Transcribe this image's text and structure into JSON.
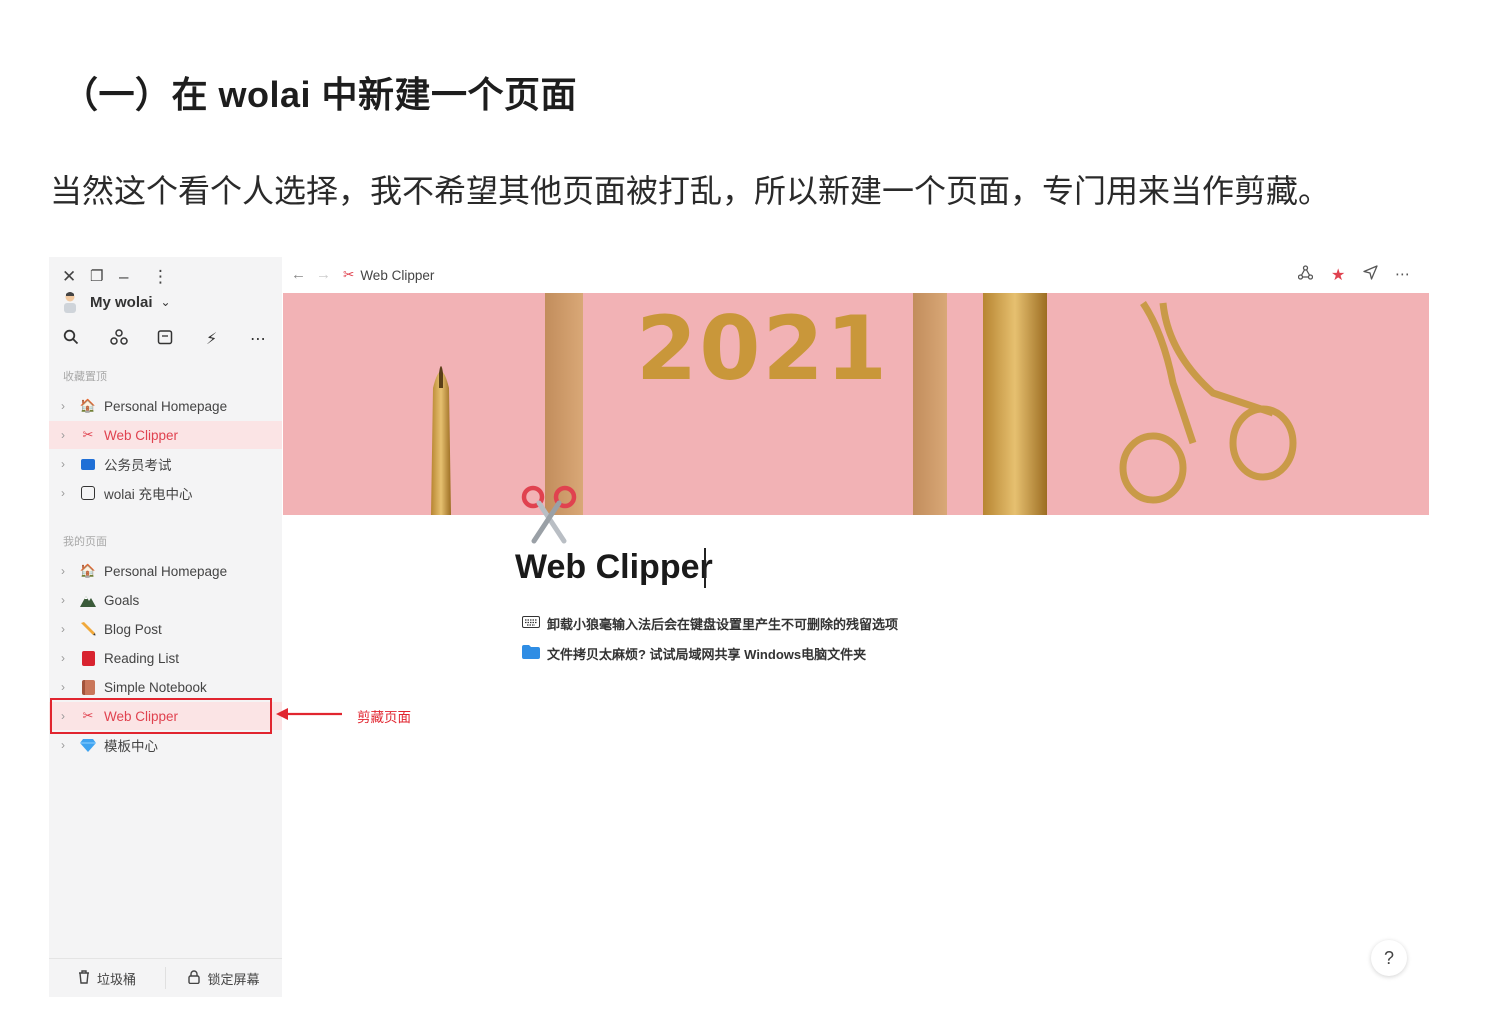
{
  "heading": "（一）在 wolai 中新建一个页面",
  "paragraph": "当然这个看个人选择，我不希望其他页面被打乱，所以新建一个页面，专门用来当作剪藏。",
  "sidebar": {
    "workspace_name": "My wolai",
    "favorites_label": "收藏置顶",
    "favorites": [
      {
        "label": "Personal Homepage",
        "icon": "house-icon"
      },
      {
        "label": "Web Clipper",
        "icon": "scissors-icon"
      },
      {
        "label": "公务员考试",
        "icon": "blue-card-icon"
      },
      {
        "label": "wolai 充电中心",
        "icon": "square-icon"
      }
    ],
    "pages_label": "我的页面",
    "pages": [
      {
        "label": "Personal Homepage",
        "icon": "house-icon"
      },
      {
        "label": "Goals",
        "icon": "mountain-icon"
      },
      {
        "label": "Blog Post",
        "icon": "pencil-icon"
      },
      {
        "label": "Reading List",
        "icon": "red-book-icon"
      },
      {
        "label": "Simple Notebook",
        "icon": "notebook-icon"
      },
      {
        "label": "Web Clipper",
        "icon": "scissors-icon"
      },
      {
        "label": "模板中心",
        "icon": "diamond-icon"
      }
    ],
    "footer": {
      "trash": "垃圾桶",
      "lock": "锁定屏幕"
    }
  },
  "topbar": {
    "breadcrumb": "Web Clipper"
  },
  "cover": {
    "year": "2021"
  },
  "page": {
    "title": "Web Clipper",
    "links": [
      {
        "text": "卸载小狼毫输入法后会在键盘设置里产生不可删除的残留选项",
        "icon": "keyboard-icon"
      },
      {
        "text": "文件拷贝太麻烦? 试试局域网共享 Windows电脑文件夹",
        "icon": "folder-icon"
      }
    ]
  },
  "annotation": "剪藏页面",
  "help": "?",
  "colors": {
    "accent": "#e0424f",
    "annotation": "#e1252f",
    "cover": "#f4b4b7",
    "gold": "#c9973a"
  }
}
